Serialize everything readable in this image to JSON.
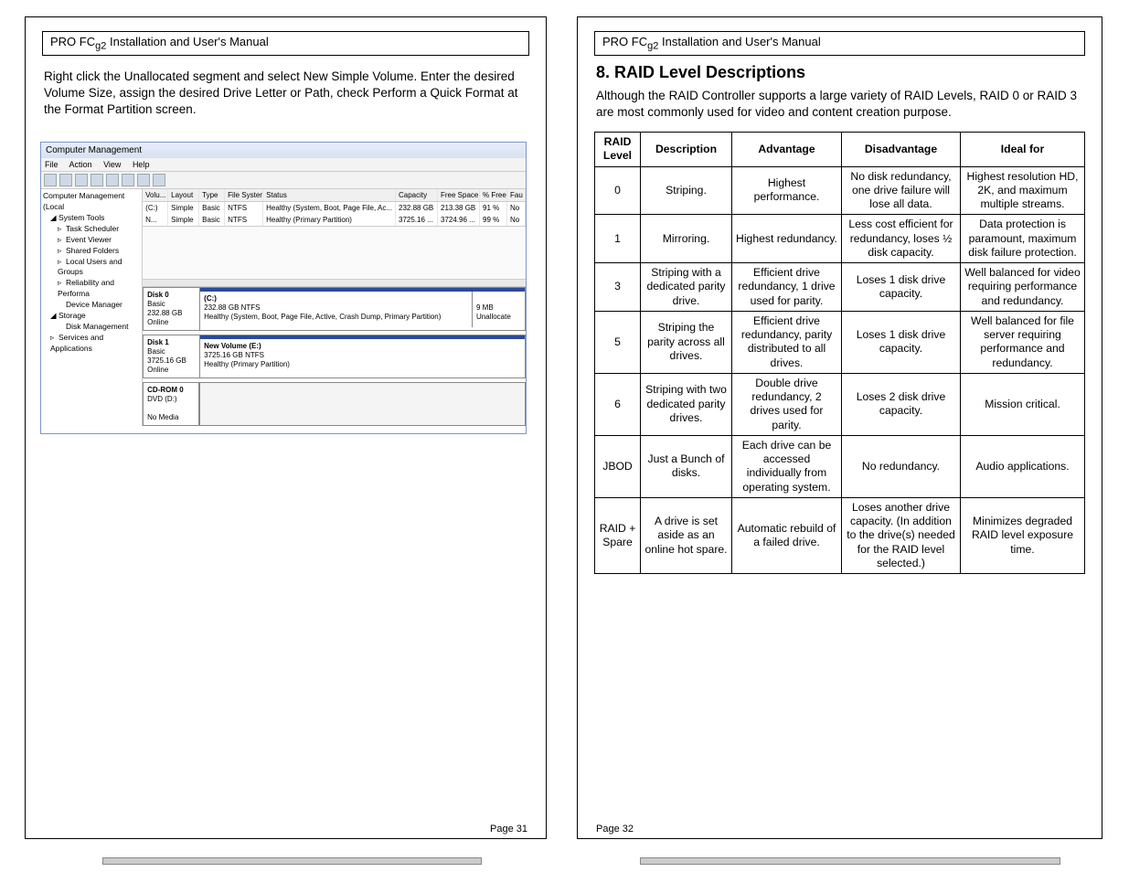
{
  "doc_title": "PRO FCg2 Installation and User's Manual",
  "left": {
    "instruction": "Right click the Unallocated segment and select New Simple Volume.  Enter the desired Volume Size, assign the desired Drive Letter or Path, check Perform a Quick Format at the Format Partition screen.",
    "page_num": "Page 31"
  },
  "cm": {
    "title": "Computer Management",
    "menu": {
      "file": "File",
      "action": "Action",
      "view": "View",
      "help": "Help"
    },
    "tree": {
      "root": "Computer Management (Local",
      "systools": "System Tools",
      "task": "Task Scheduler",
      "event": "Event Viewer",
      "shared": "Shared Folders",
      "users": "Local Users and Groups",
      "perf": "Reliability and Performa",
      "devmgr": "Device Manager",
      "storage": "Storage",
      "diskmgmt": "Disk Management",
      "services": "Services and Applications"
    },
    "cols": {
      "vol": "Volu...",
      "lay": "Layout",
      "typ": "Type",
      "fs": "File System",
      "stat": "Status",
      "cap": "Capacity",
      "free": "Free Space",
      "pct": "% Free",
      "fau": "Fau"
    },
    "rows": [
      {
        "vol": "(C:)",
        "lay": "Simple",
        "typ": "Basic",
        "fs": "NTFS",
        "stat": "Healthy (System, Boot, Page File, Ac...",
        "cap": "232.88 GB",
        "free": "213.38 GB",
        "pct": "91 %",
        "fau": "No"
      },
      {
        "vol": "N...",
        "lay": "Simple",
        "typ": "Basic",
        "fs": "NTFS",
        "stat": "Healthy (Primary Partition)",
        "cap": "3725.16 ...",
        "free": "3724.96 ...",
        "pct": "99 %",
        "fau": "No"
      }
    ],
    "disks": {
      "d0": {
        "name": "Disk 0",
        "type": "Basic",
        "size": "232.88 GB",
        "state": "Online",
        "p0_name": "(C:)",
        "p0_detail": "232.88 GB NTFS",
        "p0_status": "Healthy (System, Boot, Page File, Active, Crash Dump, Primary Partition)",
        "p1_size": "9 MB",
        "p1_status": "Unallocate"
      },
      "d1": {
        "name": "Disk 1",
        "type": "Basic",
        "size": "3725.16 GB",
        "state": "Online",
        "p0_name": "New Volume (E:)",
        "p0_detail": "3725.16 GB NTFS",
        "p0_status": "Healthy (Primary Partition)"
      },
      "cd": {
        "name": "CD-ROM 0",
        "drive": "DVD (D:)",
        "state": "No Media"
      }
    }
  },
  "right": {
    "section_title": "8. RAID Level Descriptions",
    "intro": "Although the RAID Controller supports a large variety of RAID Levels, RAID 0 or RAID 3 are most commonly used for video and content creation purpose.",
    "page_num": "Page 32",
    "headers": {
      "level": "RAID Level",
      "desc": "Description",
      "adv": "Advantage",
      "dis": "Disadvantage",
      "ideal": "Ideal for"
    },
    "rows": {
      "r0": {
        "level": "0",
        "desc": "Striping.",
        "adv": "Highest performance.",
        "dis": "No disk redundancy, one drive failure will lose all data.",
        "ideal": "Highest resolution HD, 2K, and maximum multiple streams."
      },
      "r1": {
        "level": "1",
        "desc": "Mirroring.",
        "adv": "Highest redundancy.",
        "dis": "Less cost efficient for redundancy, loses ½ disk capacity.",
        "ideal": "Data protection is paramount, maximum disk failure protection."
      },
      "r3": {
        "level": "3",
        "desc": "Striping with a dedicated parity drive.",
        "adv": "Efficient drive redundancy, 1 drive used for parity.",
        "dis": "Loses 1 disk drive capacity.",
        "ideal": "Well balanced for video requiring performance and redundancy."
      },
      "r5": {
        "level": "5",
        "desc": "Striping the parity across all drives.",
        "adv": "Efficient drive redundancy, parity distributed to all drives.",
        "dis": "Loses 1 disk drive capacity.",
        "ideal": "Well balanced for file server requiring performance and redundancy."
      },
      "r6": {
        "level": "6",
        "desc": "Striping with two dedicated parity drives.",
        "adv": "Double drive redundancy, 2 drives used for parity.",
        "dis": "Loses 2 disk drive capacity.",
        "ideal": "Mission critical."
      },
      "jbod": {
        "level": "JBOD",
        "desc": "Just a Bunch of disks.",
        "adv": "Each drive can be accessed individually from operating system.",
        "dis": "No redundancy.",
        "ideal": "Audio applications."
      },
      "spare": {
        "level": "RAID + Spare",
        "desc": "A drive is set aside as an online hot spare.",
        "adv": "Automatic rebuild of a failed drive.",
        "dis": "Loses another drive capacity.  (In addition to the drive(s) needed for the RAID level selected.)",
        "ideal": "Minimizes degraded RAID level exposure time."
      }
    }
  },
  "chart_data": {
    "type": "table",
    "title": "RAID Level Descriptions",
    "columns": [
      "RAID Level",
      "Description",
      "Advantage",
      "Disadvantage",
      "Ideal for"
    ],
    "rows": [
      [
        "0",
        "Striping.",
        "Highest performance.",
        "No disk redundancy, one drive failure will lose all data.",
        "Highest resolution HD, 2K, and maximum multiple streams."
      ],
      [
        "1",
        "Mirroring.",
        "Highest redundancy.",
        "Less cost efficient for redundancy, loses ½ disk capacity.",
        "Data protection is paramount, maximum disk failure protection."
      ],
      [
        "3",
        "Striping with a dedicated parity drive.",
        "Efficient drive redundancy, 1 drive used for parity.",
        "Loses 1 disk drive capacity.",
        "Well balanced for video requiring performance and redundancy."
      ],
      [
        "5",
        "Striping the parity across all drives.",
        "Efficient drive redundancy, parity distributed to all drives.",
        "Loses 1 disk drive capacity.",
        "Well balanced for file server requiring performance and redundancy."
      ],
      [
        "6",
        "Striping with two dedicated parity drives.",
        "Double drive redundancy, 2 drives used for parity.",
        "Loses 2 disk drive capacity.",
        "Mission critical."
      ],
      [
        "JBOD",
        "Just a Bunch of disks.",
        "Each drive can be accessed individually from operating system.",
        "No redundancy.",
        "Audio applications."
      ],
      [
        "RAID + Spare",
        "A drive is set aside as an online hot spare.",
        "Automatic rebuild of a failed drive.",
        "Loses another drive capacity. (In addition to the drive(s) needed for the RAID level selected.)",
        "Minimizes degraded RAID level exposure time."
      ]
    ]
  }
}
